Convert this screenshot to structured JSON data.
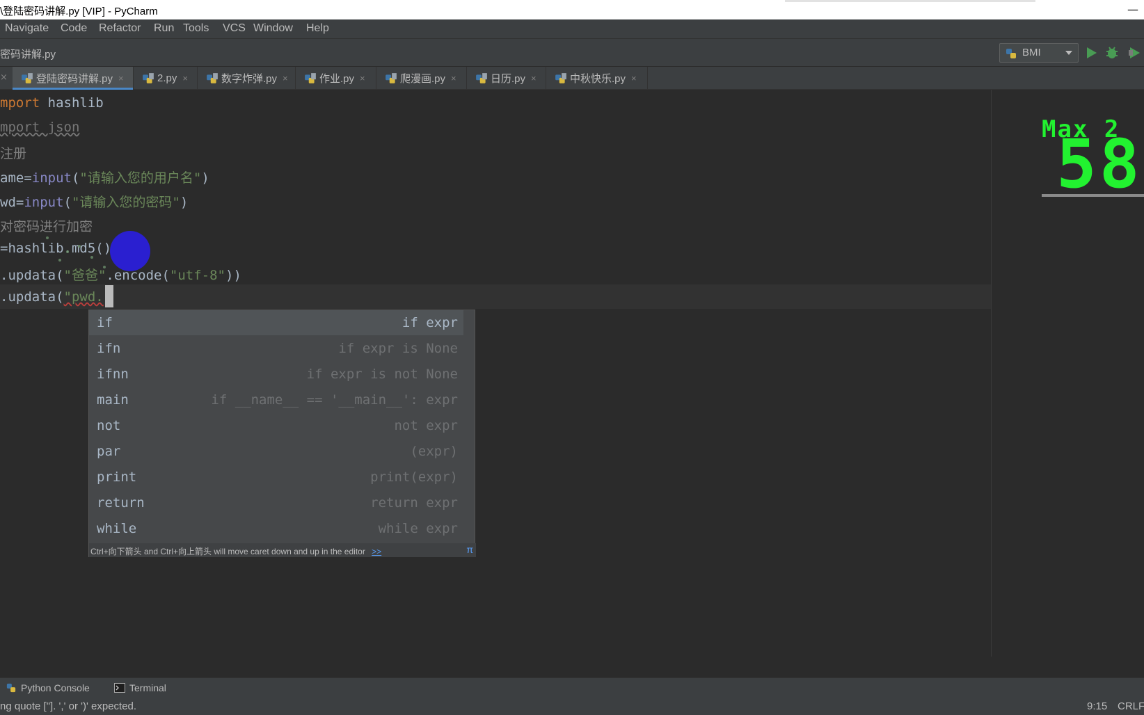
{
  "window": {
    "title": "\\登陆密码讲解.py [VIP] - PyCharm",
    "minimize_glyph": "—"
  },
  "menubar": {
    "items": [
      "Navigate",
      "Code",
      "Refactor",
      "Run",
      "Tools",
      "VCS",
      "Window",
      "Help"
    ]
  },
  "navbar": {
    "breadcrumb": "密码讲解.py",
    "run_config": "BMI",
    "icons": {
      "run": "run-icon",
      "debug": "debug-icon",
      "coverage": "coverage-icon",
      "python_file": "python-file-icon"
    }
  },
  "tabs": [
    {
      "label": "登陆密码讲解.py",
      "active": true
    },
    {
      "label": "2.py",
      "active": false
    },
    {
      "label": "数字炸弹.py",
      "active": false
    },
    {
      "label": "作业.py",
      "active": false
    },
    {
      "label": "爬漫画.py",
      "active": false
    },
    {
      "label": "日历.py",
      "active": false
    },
    {
      "label": "中秋快乐.py",
      "active": false
    }
  ],
  "tab_close_glyph": "×",
  "code": {
    "l1_kw": "mport",
    "l1_rest": " hashlib",
    "l2": "mport json",
    "l3": "注册",
    "l4_a": "ame=",
    "l4_fn": "input",
    "l4_b": "(",
    "l4_str": "\"请输入您的用户名\"",
    "l4_c": ")",
    "l5_a": "wd=",
    "l5_fn": "input",
    "l5_b": "(",
    "l5_str": "\"请输入您的密码\"",
    "l5_c": ")",
    "l6": "对密码进行加密",
    "l7": "=hashlib.md5()",
    "l8_a": ".updata(",
    "l8_str1": "\"爸爸\"",
    "l8_b": ".encode(",
    "l8_str2": "\"utf-8\"",
    "l8_c": "))",
    "l9_a": ".updata(",
    "l9_str": "\"pwd."
  },
  "completion": {
    "items": [
      {
        "key": "if",
        "template": "if expr",
        "selected": true
      },
      {
        "key": "ifn",
        "template": "if expr is None",
        "selected": false
      },
      {
        "key": "ifnn",
        "template": "if expr is not None",
        "selected": false
      },
      {
        "key": "main",
        "template": "if __name__ == '__main__': expr",
        "selected": false
      },
      {
        "key": "not",
        "template": "not expr",
        "selected": false
      },
      {
        "key": "par",
        "template": "(expr)",
        "selected": false
      },
      {
        "key": "print",
        "template": "print(expr)",
        "selected": false
      },
      {
        "key": "return",
        "template": "return expr",
        "selected": false
      },
      {
        "key": "while",
        "template": "while expr",
        "selected": false
      }
    ],
    "hint": "Ctrl+向下箭头 and Ctrl+向上箭头 will move caret down and up in the editor",
    "hint_more": ">>",
    "hint_pi": "π"
  },
  "overlay": {
    "label": "Max 2",
    "value": "58"
  },
  "toolwindows": {
    "python_console": "Python Console",
    "terminal": "Terminal"
  },
  "status": {
    "message": "ng quote [\"]. ',' or ')' expected.",
    "position": "9:15",
    "line_ending": "CRLF"
  },
  "colors": {
    "accent": "#4a88c7",
    "run_green": "#499c54",
    "overlay_green": "#22f230",
    "blue_dot": "#2a1fd0"
  }
}
